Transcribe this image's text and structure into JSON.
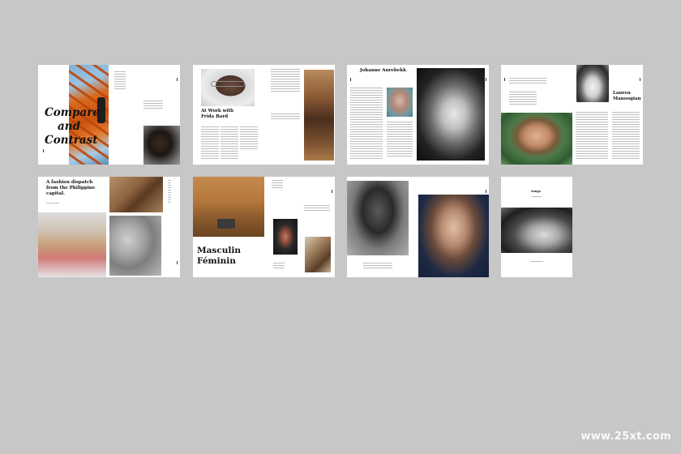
{
  "pages": {
    "compare": {
      "title_line1": "Compare",
      "title_line2": "and",
      "title_line3": "Contrast"
    },
    "at_work": {
      "title_line1": "At Work with",
      "title_line2": "Frida Bard"
    },
    "johanne": {
      "name": "Johanne Aurebekk"
    },
    "lauren": {
      "name_line1": "Lauren",
      "name_line2": "Manoogian"
    },
    "fashion": {
      "title_line1": "A fashion dispatch",
      "title_line2": "from the Philippine",
      "title_line3": "capital."
    },
    "masculin": {
      "title_line1": "Masculin",
      "title_line2": "Féminin"
    },
    "songs": {
      "title": "Songs"
    }
  },
  "watermark": "www.25xt.com"
}
